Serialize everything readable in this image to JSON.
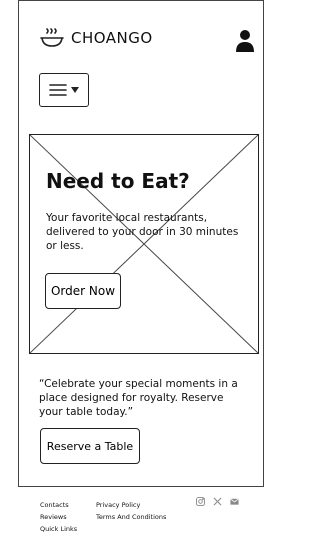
{
  "header": {
    "brand": "CHOANGO",
    "logo_icon": "food-bowl-icon",
    "user_icon": "user-icon",
    "menu_icons": [
      "hamburger-icon",
      "chevron-down-icon"
    ]
  },
  "hero": {
    "title": "Need to Eat?",
    "text": "Your favorite local restaurants, delivered to your door in 30 minutes or less.",
    "button": "Order Now",
    "image_placeholder_icon": "image-placeholder-icon"
  },
  "promo": {
    "quote": "“Celebrate your special moments in a place designed for royalty. Reserve your table today.”",
    "button": "Reserve a Table"
  },
  "footer": {
    "col1": [
      "Contacts",
      "Reviews",
      "Quick Links"
    ],
    "col2": [
      "Privacy Policy",
      "Terms And Conditions"
    ],
    "social_icons": [
      "instagram-icon",
      "x-icon",
      "mail-icon"
    ]
  },
  "colors": {
    "ink": "#111111",
    "border": "#222222",
    "muted": "#777777",
    "background": "#ffffff"
  }
}
